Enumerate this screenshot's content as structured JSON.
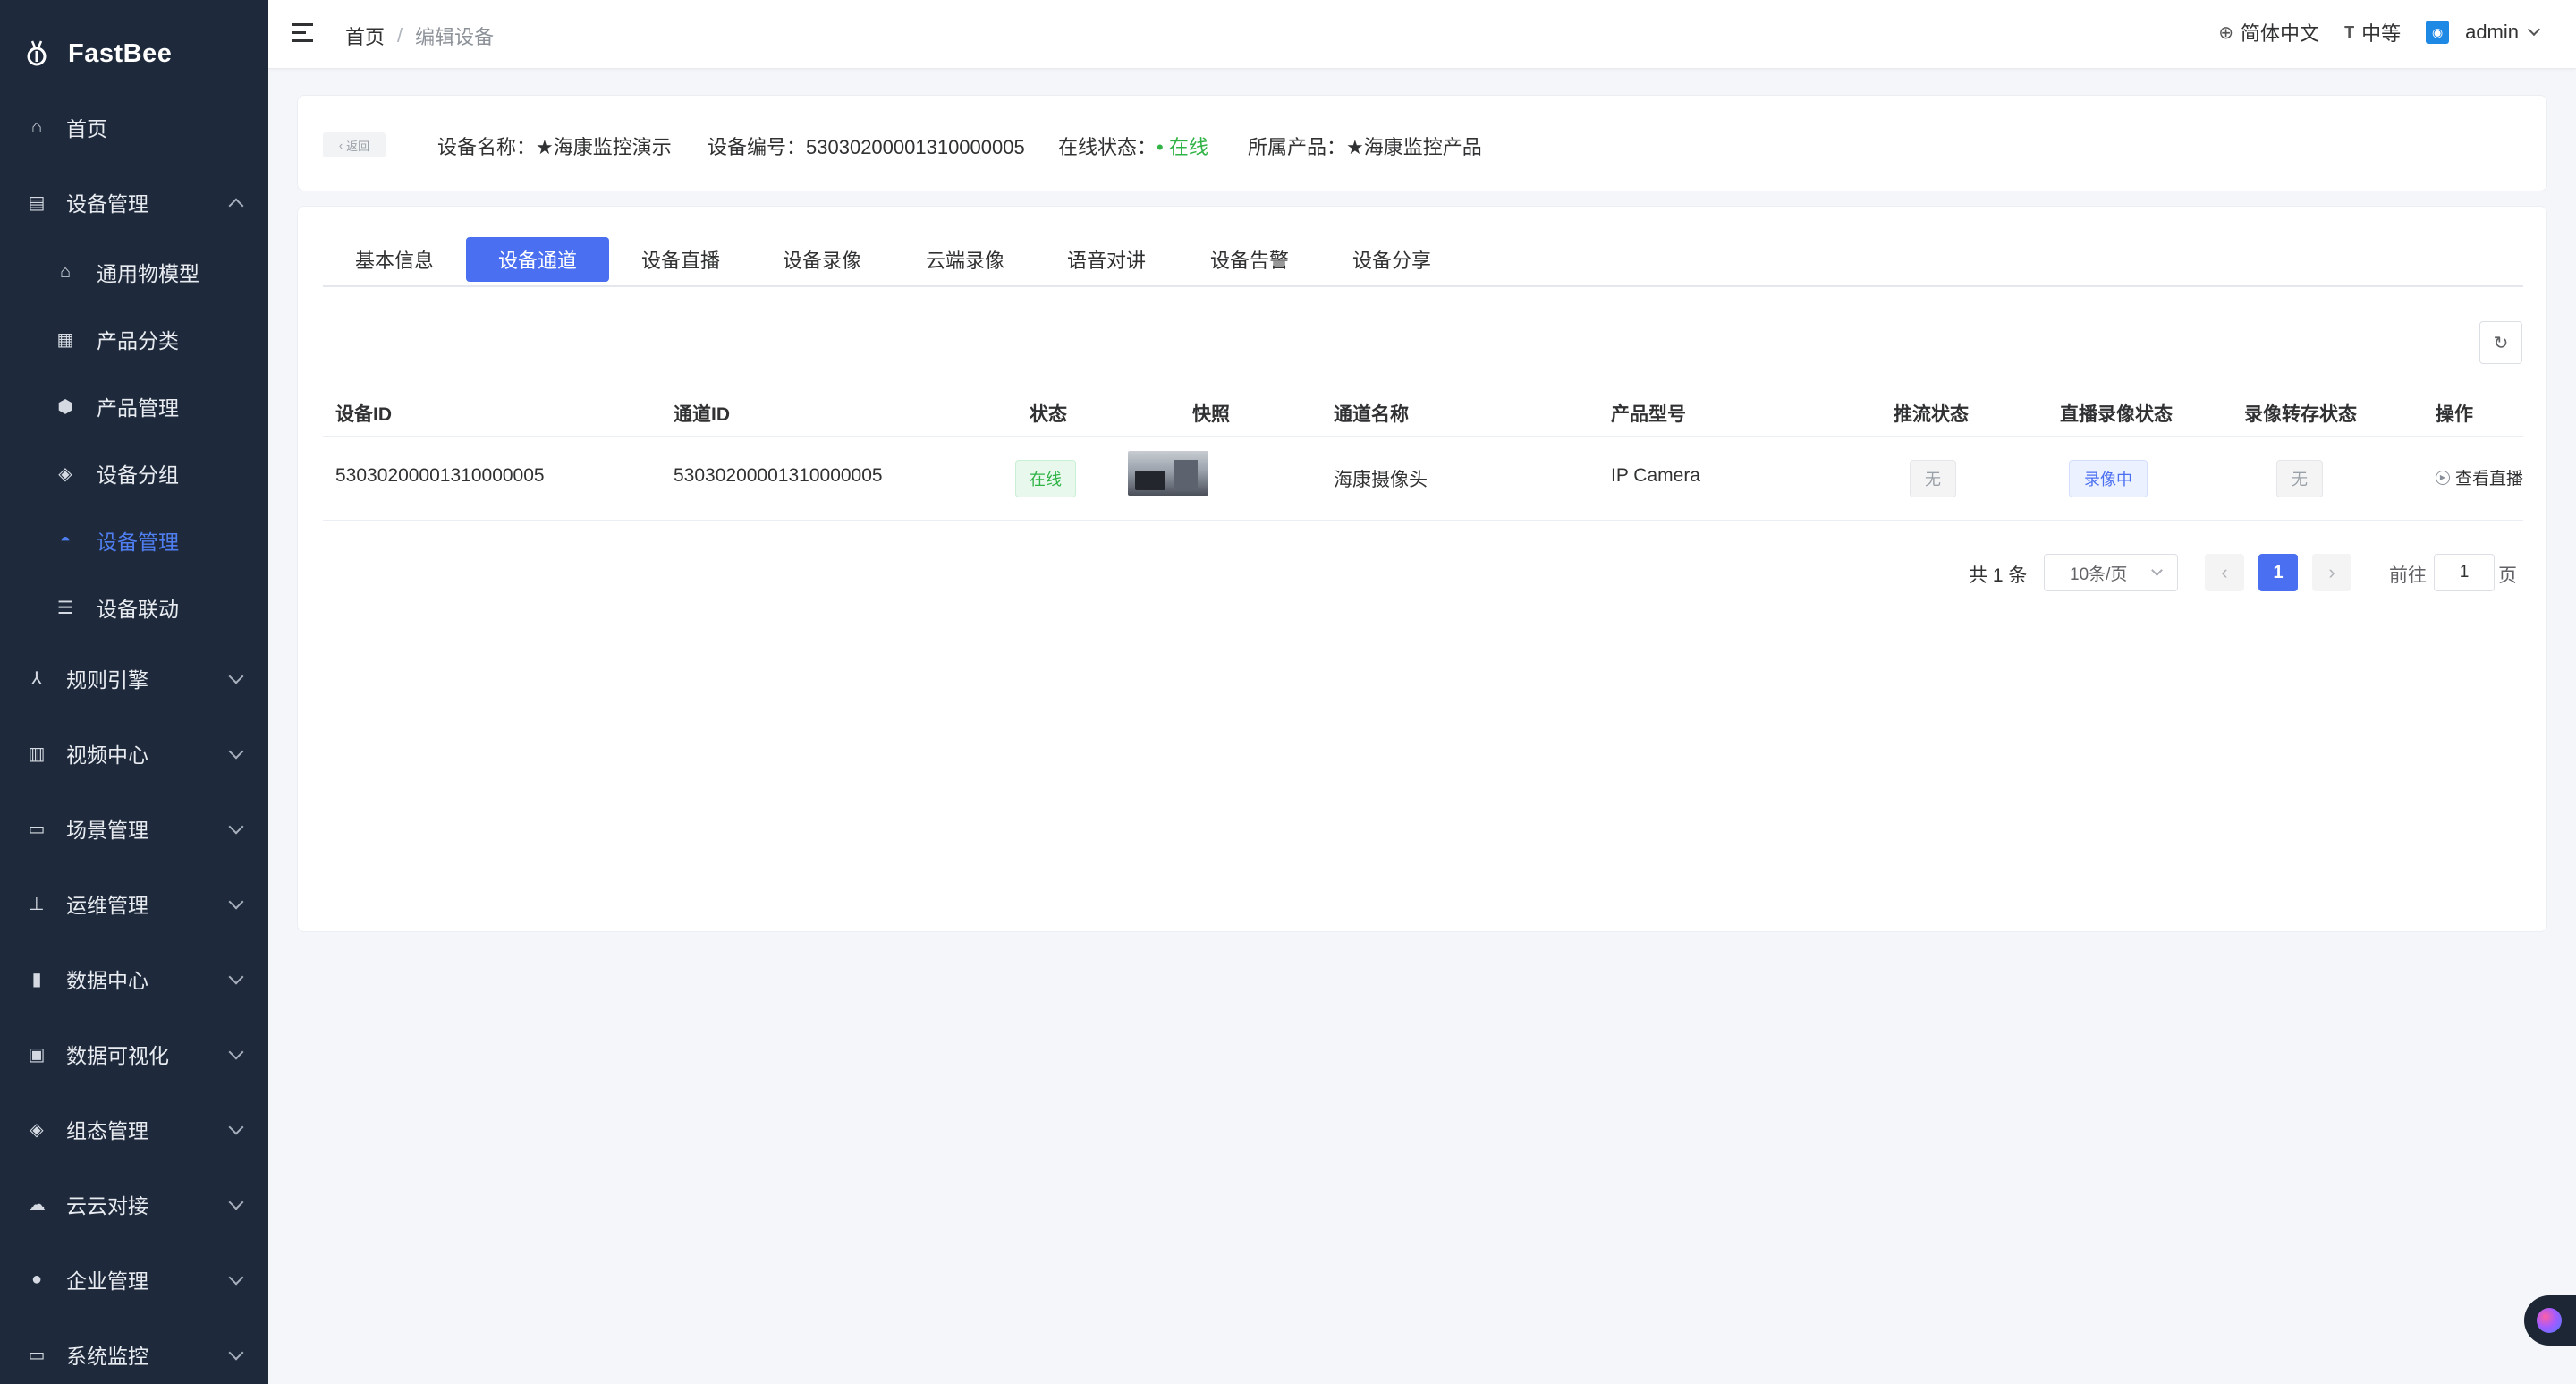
{
  "app": {
    "name": "FastBee"
  },
  "sidebar": {
    "items": [
      {
        "label": "首页",
        "icon": "home-icon",
        "glyph": "⌂"
      },
      {
        "label": "设备管理",
        "icon": "device-manage-icon",
        "glyph": "▤",
        "expanded": true
      },
      {
        "label": "通用物模型",
        "icon": "model-icon",
        "glyph": "⌂"
      },
      {
        "label": "产品分类",
        "icon": "category-icon",
        "glyph": "▦"
      },
      {
        "label": "产品管理",
        "icon": "product-icon",
        "glyph": "⬢"
      },
      {
        "label": "设备分组",
        "icon": "group-icon",
        "glyph": "◈"
      },
      {
        "label": "设备管理",
        "icon": "device-icon",
        "glyph": "◓",
        "active": true
      },
      {
        "label": "设备联动",
        "icon": "linkage-icon",
        "glyph": "☰"
      },
      {
        "label": "规则引擎",
        "icon": "rule-icon",
        "glyph": "⅄"
      },
      {
        "label": "视频中心",
        "icon": "video-icon",
        "glyph": "▥"
      },
      {
        "label": "场景管理",
        "icon": "scene-icon",
        "glyph": "▭"
      },
      {
        "label": "运维管理",
        "icon": "ops-icon",
        "glyph": "⊥"
      },
      {
        "label": "数据中心",
        "icon": "data-icon",
        "glyph": "▮"
      },
      {
        "label": "数据可视化",
        "icon": "visual-icon",
        "glyph": "▣"
      },
      {
        "label": "组态管理",
        "icon": "config-icon",
        "glyph": "◈"
      },
      {
        "label": "云云对接",
        "icon": "cloud-icon",
        "glyph": "☁"
      },
      {
        "label": "企业管理",
        "icon": "enterprise-icon",
        "glyph": "●"
      },
      {
        "label": "系统监控",
        "icon": "monitor-icon",
        "glyph": "▭"
      }
    ]
  },
  "header": {
    "breadcrumb": {
      "home": "首页",
      "sep": "/",
      "current": "编辑设备"
    },
    "language": "简体中文",
    "font_size": "中等",
    "user": "admin"
  },
  "device_info": {
    "back_label": "返回",
    "name_label": "设备名称：",
    "name": "★海康监控演示",
    "code_label": "设备编号：",
    "code": "53030200001310000005",
    "status_label": "在线状态：",
    "status": "• 在线",
    "product_label": "所属产品：",
    "product": "★海康监控产品"
  },
  "tabs": [
    "基本信息",
    "设备通道",
    "设备直播",
    "设备录像",
    "云端录像",
    "语音对讲",
    "设备告警",
    "设备分享"
  ],
  "active_tab": "设备通道",
  "table": {
    "columns": [
      "设备ID",
      "通道ID",
      "状态",
      "快照",
      "通道名称",
      "产品型号",
      "推流状态",
      "直播录像状态",
      "录像转存状态",
      "操作"
    ],
    "rows": [
      {
        "device_id": "53030200001310000005",
        "channel_id": "53030200001310000005",
        "status": "在线",
        "channel_name": "海康摄像头",
        "model": "IP Camera",
        "push_status": "无",
        "record_status": "录像中",
        "transfer_status": "无",
        "action": "查看直播"
      }
    ]
  },
  "pagination": {
    "total": "共 1 条",
    "page_size": "10条/页",
    "current_page": "1",
    "goto_label": "前往",
    "goto_value": "1",
    "page_suffix": "页"
  },
  "colors": {
    "sidebar_bg": "#1e2a3c",
    "primary": "#4a6ff0",
    "online": "#2fb344"
  }
}
